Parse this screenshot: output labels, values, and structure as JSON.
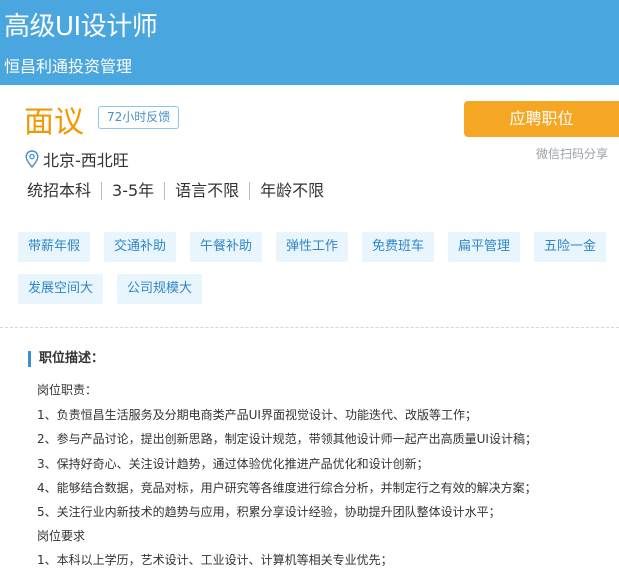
{
  "header": {
    "job_title": "高级UI设计师",
    "company": "恒昌利通投资管理"
  },
  "salary": "面议",
  "feedback_badge": "72小时反馈",
  "apply_button": "应聘职位",
  "wechat_share": "微信扫码分享",
  "location": "北京-西北旺",
  "requirements": [
    "统招本科",
    "3-5年",
    "语言不限",
    "年龄不限"
  ],
  "tags": [
    "带薪年假",
    "交通补助",
    "午餐补助",
    "弹性工作",
    "免费班车",
    "扁平管理",
    "五险一金",
    "发展空间大",
    "公司规模大"
  ],
  "description": {
    "title": "职位描述：",
    "lines": [
      "岗位职责：",
      "1、负责恒昌生活服务及分期电商类产品UI界面视觉设计、功能迭代、改版等工作；",
      "2、参与产品讨论，提出创新思路，制定设计规范，带领其他设计师一起产出高质量UI设计稿；",
      "3、保持好奇心、关注设计趋势，通过体验优化推进产品优化和设计创新；",
      "4、能够结合数据，竞品对标，用户研究等各维度进行综合分析，并制定行之有效的解决方案；",
      "5、关注行业内新技术的趋势与应用，积累分享设计经验，协助提升团队整体设计水平；",
      "岗位要求",
      "1、本科以上学历，艺术设计、工业设计、计算机等相关专业优先；"
    ]
  },
  "colors": {
    "header_bg": "#4aa6de",
    "salary": "#f39800",
    "apply_button": "#f5a623",
    "tag_bg": "#e9f5fc",
    "tag_text": "#2f86c8"
  }
}
